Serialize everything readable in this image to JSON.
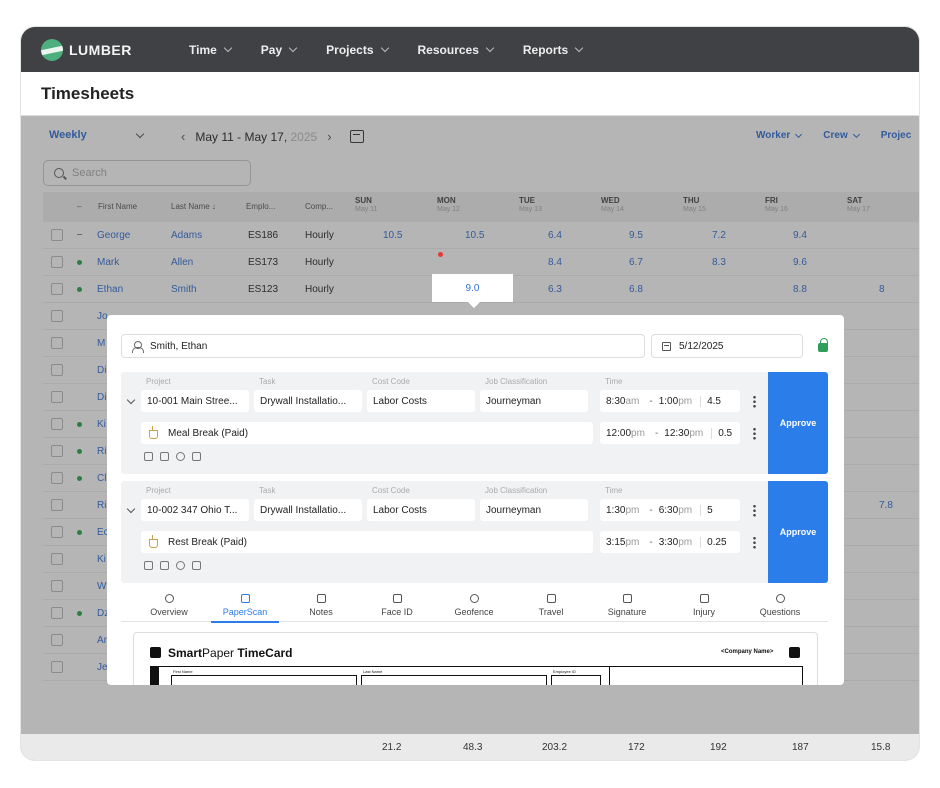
{
  "app": {
    "logo_text": "LUMBER"
  },
  "nav": [
    {
      "label": "Time"
    },
    {
      "label": "Pay"
    },
    {
      "label": "Projects"
    },
    {
      "label": "Resources"
    },
    {
      "label": "Reports"
    }
  ],
  "page": {
    "title": "Timesheets"
  },
  "toolbar": {
    "period": "Weekly",
    "range": "May 11 - May 17,",
    "range_year": "2025",
    "filters": [
      "Worker",
      "Crew",
      "Projec"
    ]
  },
  "search": {
    "placeholder": "Search"
  },
  "table": {
    "columns": [
      "First Name",
      "Last Name ↓",
      "Emplo...",
      "Comp..."
    ],
    "days": [
      {
        "day": "SUN",
        "date": "May 11"
      },
      {
        "day": "MON",
        "date": "May 12"
      },
      {
        "day": "TUE",
        "date": "May 13"
      },
      {
        "day": "WED",
        "date": "May 14"
      },
      {
        "day": "THU",
        "date": "May 15"
      },
      {
        "day": "FRI",
        "date": "May 16"
      },
      {
        "day": "SAT",
        "date": "May 17"
      }
    ],
    "rows": [
      {
        "first": "George",
        "last": "Adams",
        "emp": "ES186",
        "comp": "Hourly",
        "sun": "10.5",
        "mon": "10.5",
        "tue": "6.4",
        "wed": "9.5",
        "thu": "7.2",
        "fri": "9.4",
        "sat": ""
      },
      {
        "first": "Mark",
        "last": "Allen",
        "emp": "ES173",
        "comp": "Hourly",
        "sun": "",
        "mon": "",
        "tue": "8.4",
        "wed": "6.7",
        "thu": "8.3",
        "fri": "9.6",
        "sat": ""
      },
      {
        "first": "Ethan",
        "last": "Smith",
        "emp": "ES123",
        "comp": "Hourly",
        "sun": "",
        "mon": "9.0",
        "tue": "6.3",
        "wed": "6.8",
        "thu": "",
        "fri": "8.8",
        "sat": "8"
      }
    ],
    "partial_names": [
      "Jo",
      "M",
      "Di",
      "Di",
      "Ki",
      "Ri",
      "Cl",
      "Ri",
      "Ec",
      "Ki",
      "W",
      "Dz",
      "Ar",
      "Je"
    ],
    "side_value": "7.8"
  },
  "totals": [
    "21.2",
    "48.3",
    "203.2",
    "172",
    "192",
    "187",
    "15.8"
  ],
  "modal": {
    "worker": "Smith, Ethan",
    "date": "5/12/2025",
    "labels": {
      "project": "Project",
      "task": "Task",
      "cost_code": "Cost Code",
      "job": "Job Classification",
      "time": "Time"
    },
    "entries": [
      {
        "project": "10-001 Main Stree...",
        "task": "Drywall Installatio...",
        "cost_code": "Labor Costs",
        "job": "Journeyman",
        "start": "8:30",
        "start_ap": "am",
        "end": "1:00",
        "end_ap": "pm",
        "hours": "4.5",
        "break_label": "Meal Break (Paid)",
        "break_start": "12:00",
        "break_start_ap": "pm",
        "break_end": "12:30",
        "break_end_ap": "pm",
        "break_hours": "0.5",
        "approve": "Approve"
      },
      {
        "project": "10-002 347 Ohio T...",
        "task": "Drywall Installatio...",
        "cost_code": "Labor Costs",
        "job": "Journeyman",
        "start": "1:30",
        "start_ap": "pm",
        "end": "6:30",
        "end_ap": "pm",
        "hours": "5",
        "break_label": "Rest Break (Paid)",
        "break_start": "3:15",
        "break_start_ap": "pm",
        "break_end": "3:30",
        "break_end_ap": "pm",
        "break_hours": "0.25",
        "approve": "Approve"
      }
    ],
    "tabs": [
      "Overview",
      "PaperScan",
      "Notes",
      "Face ID",
      "Geofence",
      "Travel",
      "Signature",
      "Injury",
      "Questions"
    ],
    "active_tab": "PaperScan",
    "paper": {
      "brand_bold": "Smart",
      "brand_regular": "Paper",
      "brand_tail": " TimeCard",
      "company": "<Company Name>",
      "fields": [
        "First Name",
        "Last Name",
        "Employee ID"
      ]
    }
  },
  "colors": {
    "nav_bg": "#3f4145",
    "accent": "#2b7de9",
    "link": "#2e6fd6",
    "status_green": "#28a745"
  }
}
